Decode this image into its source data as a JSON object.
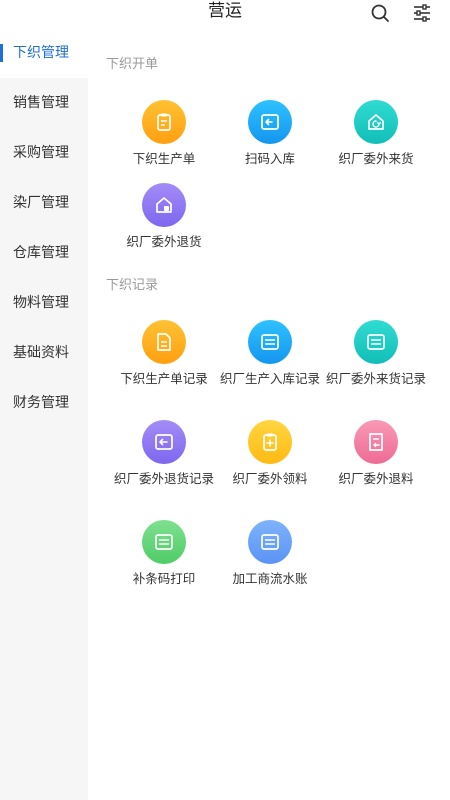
{
  "header": {
    "title": "营运",
    "search_icon": "search-icon",
    "filter_icon": "filter-icon"
  },
  "sidebar": {
    "active_index": 0,
    "items": [
      {
        "label": "下织管理"
      },
      {
        "label": "销售管理"
      },
      {
        "label": "采购管理"
      },
      {
        "label": "染厂管理"
      },
      {
        "label": "仓库管理"
      },
      {
        "label": "物料管理"
      },
      {
        "label": "基础资料"
      },
      {
        "label": "财务管理"
      }
    ]
  },
  "sections": [
    {
      "title": "下织开单",
      "tiles": [
        {
          "label": "下织生产单",
          "color": "#ffb020",
          "icon": "clipboard-icon"
        },
        {
          "label": "扫码入库",
          "color": "#1aa7f5",
          "icon": "scan-in-icon"
        },
        {
          "label": "织厂委外来货",
          "color": "#18c8c0",
          "icon": "home-return-icon"
        },
        {
          "label": "织厂委外退货",
          "color": "#8c76f2",
          "icon": "home-return-goods-icon"
        }
      ]
    },
    {
      "title": "下织记录",
      "tiles": [
        {
          "label": "下织生产单记录",
          "color": "#ffb020",
          "icon": "document-icon"
        },
        {
          "label": "织厂生产入库记录",
          "color": "#1aa7f5",
          "icon": "list-icon"
        },
        {
          "label": "织厂委外来货记录",
          "color": "#18c8c0",
          "icon": "list-icon"
        },
        {
          "label": "织厂委外退货记录",
          "color": "#8c76f2",
          "icon": "return-arrow-icon"
        },
        {
          "label": "织厂委外领料",
          "color": "#ffc326",
          "icon": "material-pickup-icon"
        },
        {
          "label": "织厂委外退料",
          "color": "#f07ba0",
          "icon": "document-return-icon"
        },
        {
          "label": "补条码打印",
          "color": "#5fd478",
          "icon": "list-icon"
        },
        {
          "label": "加工商流水账",
          "color": "#6aa2f8",
          "icon": "list-icon"
        }
      ]
    }
  ]
}
